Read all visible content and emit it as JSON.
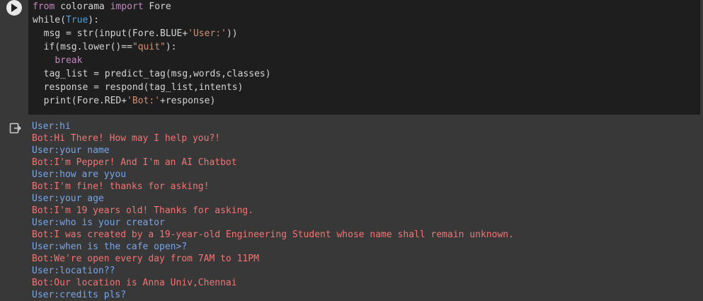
{
  "code": {
    "lines": [
      [
        {
          "t": "from",
          "c": "kw"
        },
        {
          "t": " colorama ",
          "c": ""
        },
        {
          "t": "import",
          "c": "kw"
        },
        {
          "t": " Fore",
          "c": ""
        }
      ],
      [
        {
          "t": "while(",
          "c": ""
        },
        {
          "t": "True",
          "c": "bool"
        },
        {
          "t": "):",
          "c": ""
        }
      ],
      [
        {
          "t": "  msg = str(input(Fore.BLUE+",
          "c": ""
        },
        {
          "t": "'User:'",
          "c": "str"
        },
        {
          "t": "))",
          "c": ""
        }
      ],
      [
        {
          "t": "  if(msg.lower()==",
          "c": ""
        },
        {
          "t": "\"quit\"",
          "c": "str"
        },
        {
          "t": "):",
          "c": ""
        }
      ],
      [
        {
          "t": "    ",
          "c": ""
        },
        {
          "t": "break",
          "c": "kw"
        }
      ],
      [
        {
          "t": "  tag_list = predict_tag(msg,words,classes)",
          "c": ""
        }
      ],
      [
        {
          "t": "  response = respond(tag_list,intents)",
          "c": ""
        }
      ],
      [
        {
          "t": "  print(Fore.RED+",
          "c": ""
        },
        {
          "t": "'Bot:'",
          "c": "str"
        },
        {
          "t": "+response)",
          "c": ""
        }
      ]
    ]
  },
  "output": {
    "lines": [
      {
        "text": "User:hi",
        "who": "user"
      },
      {
        "text": "Bot:Hi There! How may I help you?!",
        "who": "bot"
      },
      {
        "text": "User:your name",
        "who": "user"
      },
      {
        "text": "Bot:I'm Pepper! And I'm an AI Chatbot",
        "who": "bot"
      },
      {
        "text": "User:how are yyou",
        "who": "user"
      },
      {
        "text": "Bot:I'm fine! thanks for asking!",
        "who": "bot"
      },
      {
        "text": "User:your age",
        "who": "user"
      },
      {
        "text": "Bot:I'm 19 years old! Thanks for asking.",
        "who": "bot"
      },
      {
        "text": "User:who is your creator",
        "who": "user"
      },
      {
        "text": "Bot:I was created by a 19-year-old Engineering Student whose name shall remain unknown.",
        "who": "bot"
      },
      {
        "text": "User:when is the cafe open>?",
        "who": "user"
      },
      {
        "text": "Bot:We're open every day from 7AM to 11PM",
        "who": "bot"
      },
      {
        "text": "User:location??",
        "who": "user"
      },
      {
        "text": "Bot:Our location is Anna Univ,Chennai",
        "who": "bot"
      },
      {
        "text": "User:credits pls?",
        "who": "user"
      }
    ]
  },
  "colors": {
    "code_bg": "#1e1e1e",
    "output_bg": "#383838",
    "user": "#79a5e8",
    "bot": "#f07575",
    "keyword": "#c586c0",
    "string": "#ce9178",
    "boolean": "#569cd6"
  },
  "icons": {
    "run": "play-icon",
    "output": "output-redirect-icon"
  }
}
